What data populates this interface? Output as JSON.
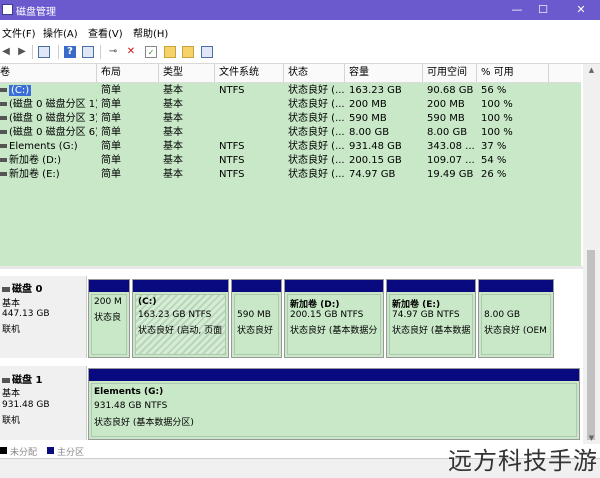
{
  "window": {
    "title": "磁盘管理"
  },
  "window_buttons": {
    "minimize": "—",
    "maximize": "☐",
    "close": "✕"
  },
  "menu": [
    "文件(F)",
    "操作(A)",
    "查看(V)",
    "帮助(H)"
  ],
  "columns": [
    "卷",
    "布局",
    "类型",
    "文件系统",
    "状态",
    "容量",
    "可用空间",
    "% 可用"
  ],
  "volumes": [
    {
      "name": "(C:)",
      "layout": "简单",
      "type": "基本",
      "fs": "NTFS",
      "status": "状态良好 (...",
      "capacity": "163.23 GB",
      "free": "90.68 GB",
      "pct": "56 %"
    },
    {
      "name": "(磁盘 0 磁盘分区 1)",
      "layout": "简单",
      "type": "基本",
      "fs": "",
      "status": "状态良好 (...",
      "capacity": "200 MB",
      "free": "200 MB",
      "pct": "100 %"
    },
    {
      "name": "(磁盘 0 磁盘分区 3)",
      "layout": "简单",
      "type": "基本",
      "fs": "",
      "status": "状态良好 (...",
      "capacity": "590 MB",
      "free": "590 MB",
      "pct": "100 %"
    },
    {
      "name": "(磁盘 0 磁盘分区 6)",
      "layout": "简单",
      "type": "基本",
      "fs": "",
      "status": "状态良好 (...",
      "capacity": "8.00 GB",
      "free": "8.00 GB",
      "pct": "100 %"
    },
    {
      "name": "Elements (G:)",
      "layout": "简单",
      "type": "基本",
      "fs": "NTFS",
      "status": "状态良好 (...",
      "capacity": "931.48 GB",
      "free": "343.08 ...",
      "pct": "37 %"
    },
    {
      "name": "新加卷 (D:)",
      "layout": "简单",
      "type": "基本",
      "fs": "NTFS",
      "status": "状态良好 (...",
      "capacity": "200.15 GB",
      "free": "109.07 ...",
      "pct": "54 %"
    },
    {
      "name": "新加卷 (E:)",
      "layout": "简单",
      "type": "基本",
      "fs": "NTFS",
      "status": "状态良好 (...",
      "capacity": "74.97 GB",
      "free": "19.49 GB",
      "pct": "26 %"
    }
  ],
  "disk0": {
    "title": "磁盘 0",
    "type": "基本",
    "size": "447.13 GB",
    "state": "联机",
    "parts": [
      {
        "name": "",
        "size": "200 M",
        "status": "状态良"
      },
      {
        "name": "(C:)",
        "size": "163.23 GB NTFS",
        "status": "状态良好 (启动, 页面"
      },
      {
        "name": "",
        "size": "590 MB",
        "status": "状态良好"
      },
      {
        "name": "新加卷  (D:)",
        "size": "200.15 GB NTFS",
        "status": "状态良好 (基本数据分"
      },
      {
        "name": "新加卷  (E:)",
        "size": "74.97 GB NTFS",
        "status": "状态良好 (基本数据"
      },
      {
        "name": "",
        "size": "8.00 GB",
        "status": "状态良好 (OEM"
      }
    ]
  },
  "disk1": {
    "title": "磁盘 1",
    "type": "基本",
    "size": "931.48 GB",
    "state": "联机",
    "parts": [
      {
        "name": "Elements  (G:)",
        "size": "931.48 GB NTFS",
        "status": "状态良好 (基本数据分区)"
      }
    ]
  },
  "legend": {
    "unallocated": "未分配",
    "primary": "主分区"
  },
  "colors": {
    "title_bar": "#6a5acd",
    "partition_bar": "#0a0a80",
    "volume_bg": "#c8e8c8"
  },
  "watermark": "远方科技手游"
}
